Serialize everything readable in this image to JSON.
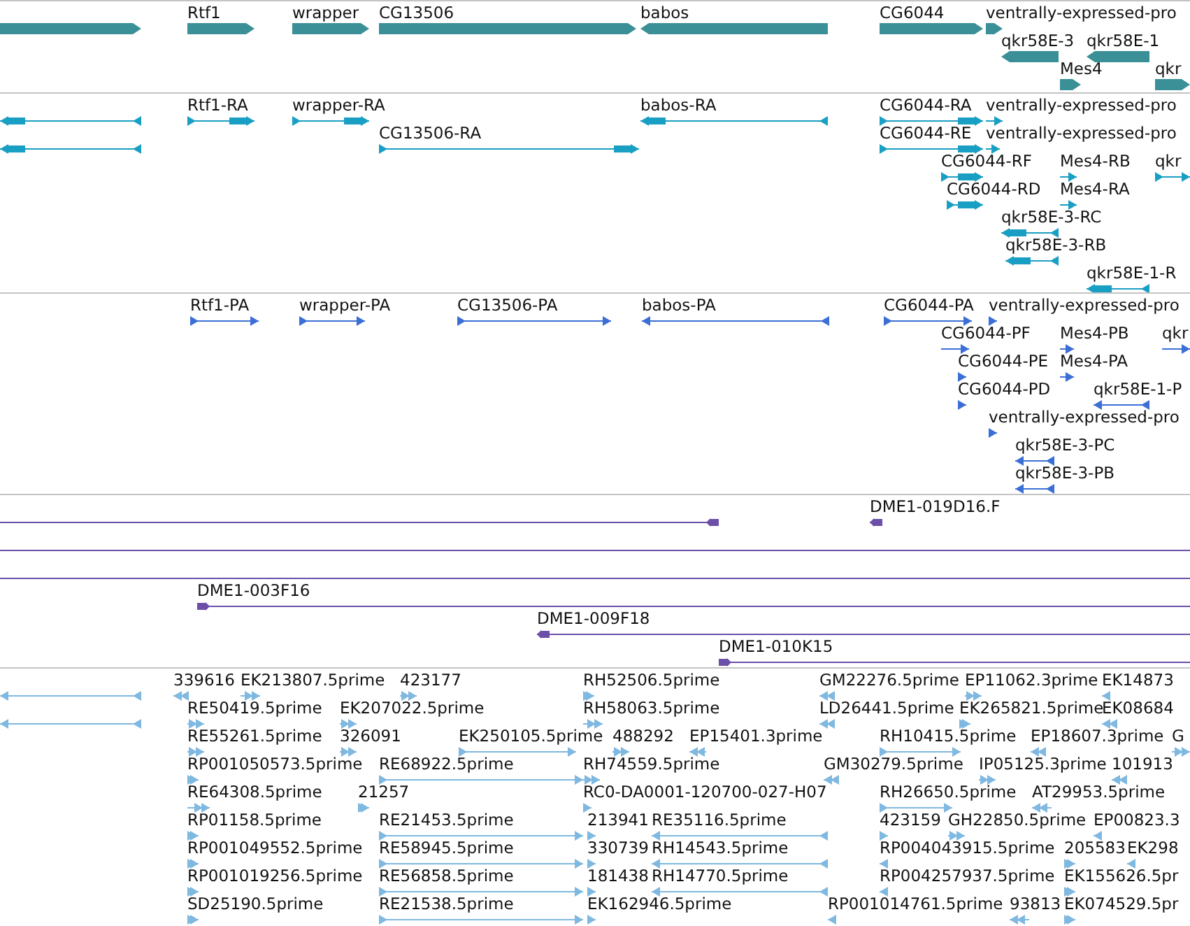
{
  "tracks": [
    {
      "kind": "gene",
      "features": [
        {
          "reverse": false
        },
        {
          "label": "Rtf1",
          "reverse": false
        },
        {
          "label": "wrapper",
          "reverse": false
        },
        {
          "label": "CG13506",
          "reverse": false
        },
        {
          "label": "babos",
          "reverse": true
        },
        {
          "label": "CG6044",
          "reverse": false
        },
        {
          "label": "ventrally-expressed-pro",
          "reverse": false
        },
        {
          "label": "qkr58E-3",
          "reverse": true
        },
        {
          "label": "qkr58E-1",
          "reverse": true
        },
        {
          "label": "Mes4",
          "reverse": false
        },
        {
          "label": "qkr",
          "reverse": false
        }
      ]
    },
    {
      "kind": "transcript",
      "features": [
        {
          "reverse": true
        },
        {
          "label": "Rtf1-RA",
          "reverse": false
        },
        {
          "label": "wrapper-RA",
          "reverse": false
        },
        {
          "label": "babos-RA",
          "reverse": true
        },
        {
          "label": "CG6044-RA",
          "reverse": false
        },
        {
          "label": "ventrally-expressed-pro",
          "reverse": false
        },
        {
          "reverse": true
        },
        {
          "label": "CG13506-RA",
          "reverse": false
        },
        {
          "label": "CG6044-RE",
          "reverse": false
        },
        {
          "label": "ventrally-expressed-pro",
          "reverse": false
        },
        {
          "label": "CG6044-RF",
          "reverse": false
        },
        {
          "label": "Mes4-RB",
          "reverse": false
        },
        {
          "label": "qkr",
          "reverse": false
        },
        {
          "label": "CG6044-RD",
          "reverse": false
        },
        {
          "label": "Mes4-RA",
          "reverse": false
        },
        {
          "label": "qkr58E-3-RC",
          "reverse": true
        },
        {
          "label": "qkr58E-3-RB",
          "reverse": true
        },
        {
          "label": "qkr58E-1-R",
          "reverse": true
        }
      ]
    },
    {
      "kind": "protein",
      "features": [
        {
          "label": "Rtf1-PA",
          "reverse": false
        },
        {
          "label": "wrapper-PA",
          "reverse": false
        },
        {
          "label": "CG13506-PA",
          "reverse": false
        },
        {
          "label": "babos-PA",
          "reverse": true
        },
        {
          "label": "CG6044-PA",
          "reverse": false
        },
        {
          "label": "ventrally-expressed-pro",
          "reverse": false
        },
        {
          "label": "CG6044-PF",
          "reverse": false
        },
        {
          "label": "Mes4-PB",
          "reverse": false
        },
        {
          "label": "qkr",
          "reverse": false
        },
        {
          "label": "CG6044-PE",
          "reverse": false
        },
        {
          "label": "Mes4-PA",
          "reverse": false
        },
        {
          "label": "CG6044-PD",
          "reverse": false
        },
        {
          "label": "qkr58E-1-P",
          "reverse": true
        },
        {
          "label": "ventrally-expressed-pro",
          "reverse": false
        },
        {
          "label": "qkr58E-3-PC",
          "reverse": true
        },
        {
          "label": "qkr58E-3-PB",
          "reverse": true
        }
      ]
    },
    {
      "kind": "clone",
      "features": [
        {
          "kind": "arrow",
          "reverse": true
        },
        {
          "kind": "arrow",
          "label": "DME1-019D16.F",
          "reverse": true
        },
        {
          "kind": "plain"
        },
        {
          "kind": "plain"
        },
        {
          "kind": "arrow",
          "label": "DME1-003F16",
          "reverse": false
        },
        {
          "kind": "arrow",
          "label": "DME1-009F18",
          "reverse": true
        },
        {
          "kind": "arrow",
          "label": "DME1-010K15",
          "reverse": false
        }
      ]
    },
    {
      "kind": "est",
      "features": [
        {
          "reverse": true
        },
        {
          "label": "339616",
          "reverse": true
        },
        {
          "label": "EK213807.5prime",
          "reverse": false
        },
        {
          "label": "423177",
          "reverse": false
        },
        {
          "label": "RH52506.5prime",
          "reverse": false
        },
        {
          "label": "GM22276.5prime",
          "reverse": true
        },
        {
          "label": "EP11062.3prime",
          "reverse": false
        },
        {
          "label": "EK14873",
          "reverse": true
        },
        {
          "reverse": true
        },
        {
          "label": "RE50419.5prime",
          "reverse": false
        },
        {
          "label": "EK207022.5prime",
          "reverse": false
        },
        {
          "label": "RH58063.5prime",
          "reverse": false
        },
        {
          "label": "LD26441.5prime",
          "reverse": true
        },
        {
          "label": "EK265821.5prime",
          "reverse": false
        },
        {
          "label": "EK08684",
          "reverse": true
        },
        {
          "label": "RE55261.5prime",
          "reverse": false
        },
        {
          "label": "326091",
          "reverse": false
        },
        {
          "label": "EK250105.5prime",
          "reverse": false
        },
        {
          "label": "488292",
          "reverse": false
        },
        {
          "label": "EP15401.3prime",
          "reverse": true
        },
        {
          "label": "RH10415.5prime",
          "reverse": false
        },
        {
          "label": "EP18607.3prime",
          "reverse": true
        },
        {
          "label": "G",
          "reverse": false
        },
        {
          "label": "RP001050573.5prime",
          "reverse": false
        },
        {
          "label": "RE68922.5prime",
          "reverse": false
        },
        {
          "label": "RH74559.5prime",
          "reverse": false
        },
        {
          "label": "GM30279.5prime",
          "reverse": true
        },
        {
          "label": "IP05125.3prime",
          "reverse": false
        },
        {
          "label": "101913",
          "reverse": true
        },
        {
          "label": "RE64308.5prime",
          "reverse": false
        },
        {
          "label": "21257",
          "reverse": false
        },
        {
          "label": "RC0-DA0001-120700-027-H07",
          "reverse": false
        },
        {
          "label": "RH26650.5prime",
          "reverse": false
        },
        {
          "label": "AT29953.5prime",
          "reverse": true
        },
        {
          "label": "RP01158.5prime",
          "reverse": false
        },
        {
          "label": "RE21453.5prime",
          "reverse": false
        },
        {
          "label": "213941",
          "reverse": false
        },
        {
          "label": "RE35116.5prime",
          "reverse": true
        },
        {
          "label": "423159",
          "reverse": false
        },
        {
          "label": "GH22850.5prime",
          "reverse": false
        },
        {
          "label": "EP00823.3",
          "reverse": true
        },
        {
          "label": "RP001049552.5prime",
          "reverse": false
        },
        {
          "label": "RE58945.5prime",
          "reverse": false
        },
        {
          "label": "330739",
          "reverse": false
        },
        {
          "label": "RH14543.5prime",
          "reverse": true
        },
        {
          "label": "RP004043915.5prime",
          "reverse": true
        },
        {
          "label": "205583",
          "reverse": false
        },
        {
          "label": "EK298",
          "reverse": true
        },
        {
          "label": "RP001019256.5prime",
          "reverse": false
        },
        {
          "label": "RE56858.5prime",
          "reverse": false
        },
        {
          "label": "181438",
          "reverse": false
        },
        {
          "label": "RH14770.5prime",
          "reverse": true
        },
        {
          "label": "RP004257937.5prime",
          "reverse": true
        },
        {
          "label": "EK155626.5pr",
          "reverse": false
        },
        {
          "label": "SD25190.5prime",
          "reverse": false
        },
        {
          "label": "RE21538.5prime",
          "reverse": false
        },
        {
          "label": "EK162946.5prime",
          "reverse": false
        },
        {
          "label": "RP001014761.5prime",
          "reverse": true
        },
        {
          "label": "93813",
          "reverse": true
        },
        {
          "label": "EK074529.5pr",
          "reverse": false
        }
      ]
    }
  ]
}
